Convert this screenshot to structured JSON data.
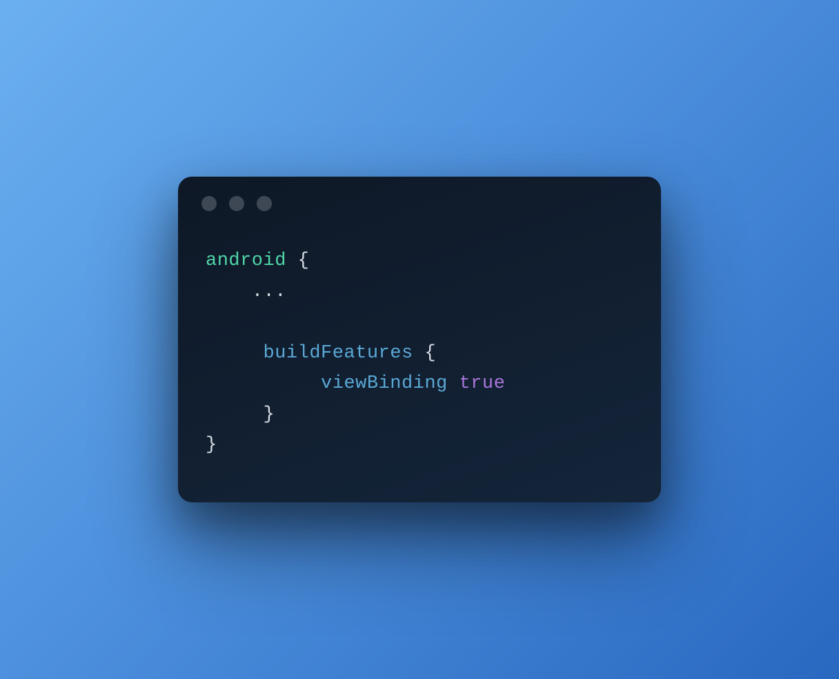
{
  "code": {
    "line1_keyword": "android",
    "line1_brace": " {",
    "line2_indent": "    ",
    "line2_dots": "...",
    "line3_blank": "",
    "line4_indent": "     ",
    "line4_property": "buildFeatures",
    "line4_brace": " {",
    "line5_indent": "          ",
    "line5_identifier": "viewBinding",
    "line5_space": " ",
    "line5_boolean": "true",
    "line6_indent": "     ",
    "line6_brace": "}",
    "line7_brace": "}"
  }
}
